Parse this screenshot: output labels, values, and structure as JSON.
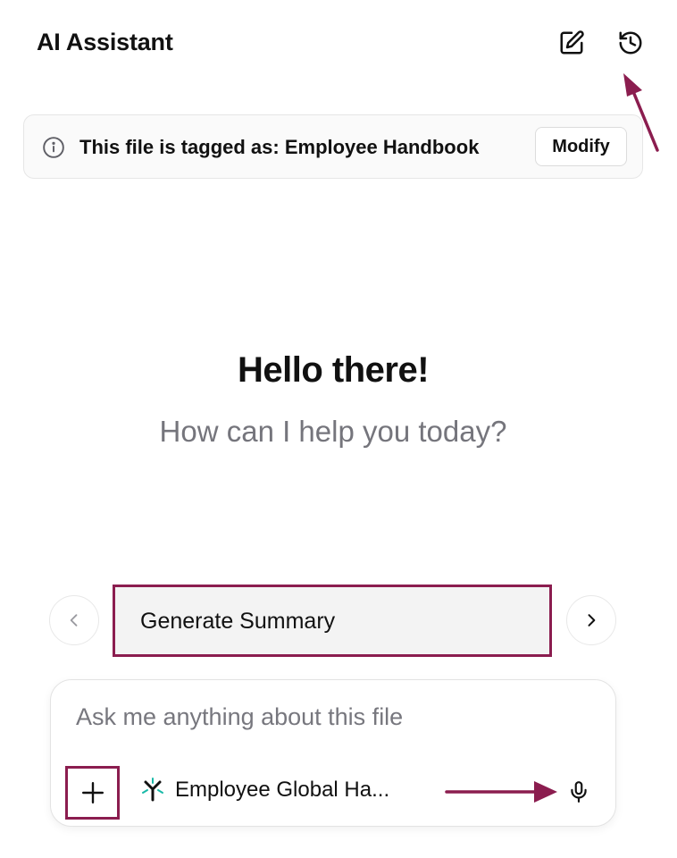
{
  "header": {
    "title": "AI Assistant",
    "new_chat_icon": "edit-icon",
    "history_icon": "history-icon"
  },
  "tag_banner": {
    "icon": "info-icon",
    "text": "This file is tagged as: Employee Handbook",
    "modify_label": "Modify"
  },
  "greeting": {
    "heading": "Hello there!",
    "subheading": "How can I help you today?"
  },
  "suggestions": {
    "prev_icon": "chevron-left-icon",
    "next_icon": "chevron-right-icon",
    "items": [
      {
        "label": "Generate Summary"
      }
    ]
  },
  "composer": {
    "placeholder": "Ask me anything about this file",
    "attach_icon": "plus-icon",
    "file_icon": "file-logo-icon",
    "file_name": "Employee Global Ha...",
    "mic_icon": "microphone-icon"
  },
  "colors": {
    "annotation": "#8b1d4f",
    "muted_text": "#75757c",
    "chip_background": "#f3f3f3"
  }
}
